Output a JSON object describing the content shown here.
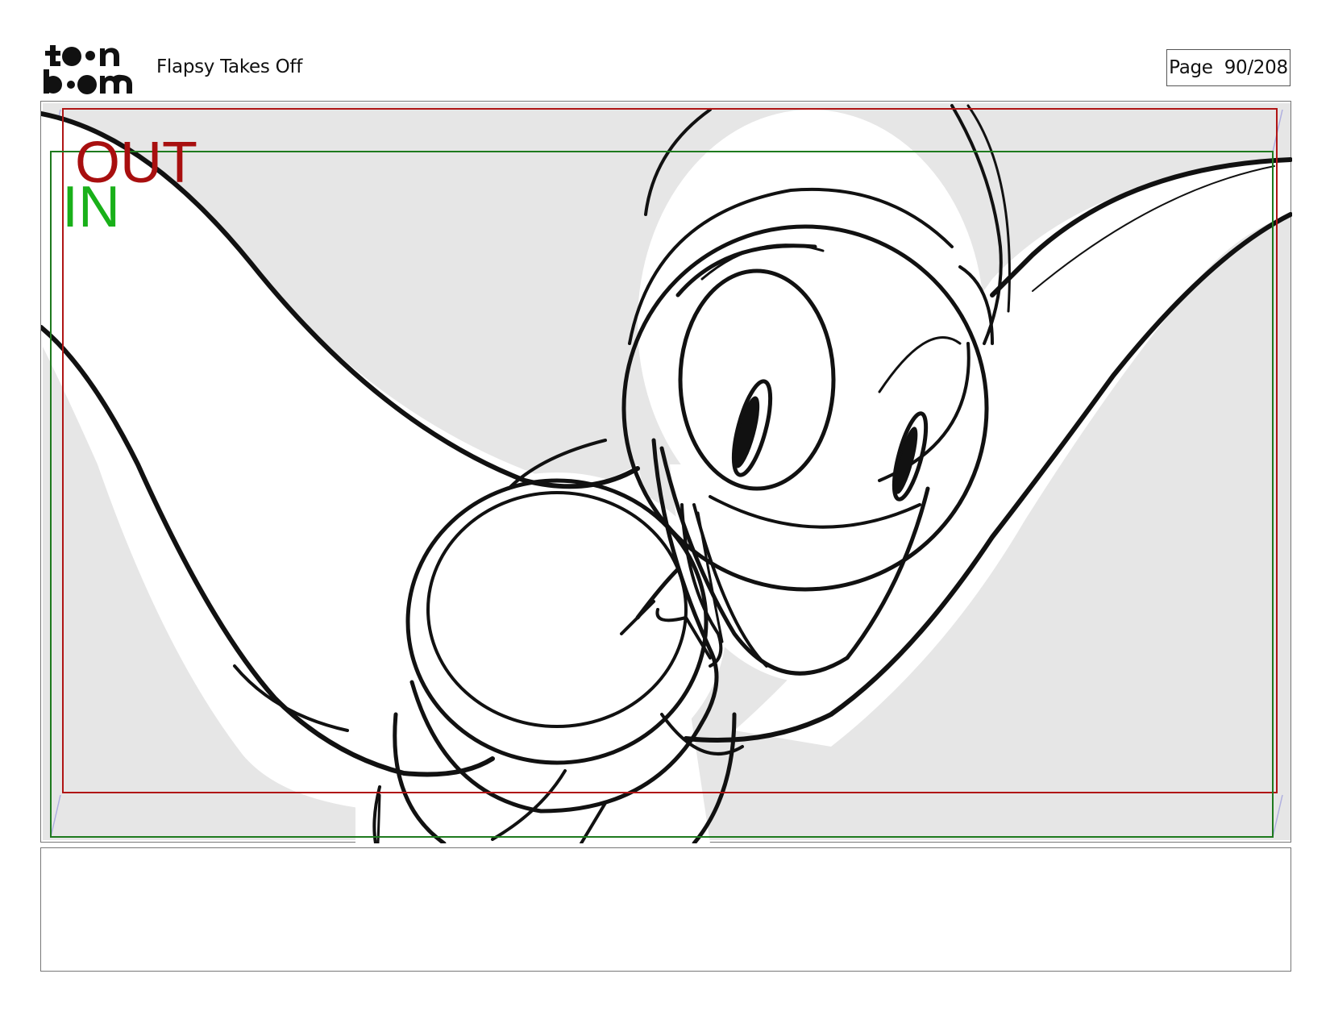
{
  "header": {
    "logo_text": "toon boom",
    "project_title": "Flapsy Takes Off",
    "page_label": "Page",
    "page_number": "90/208"
  },
  "panel": {
    "out_label": "OUT",
    "in_label": "IN",
    "colors": {
      "out_frame": "#b01515",
      "in_frame": "#1e7a1e",
      "in_text": "#19b019",
      "out_text": "#a80f0f",
      "background": "#e6e6e6"
    }
  },
  "notes": {
    "text": ""
  }
}
